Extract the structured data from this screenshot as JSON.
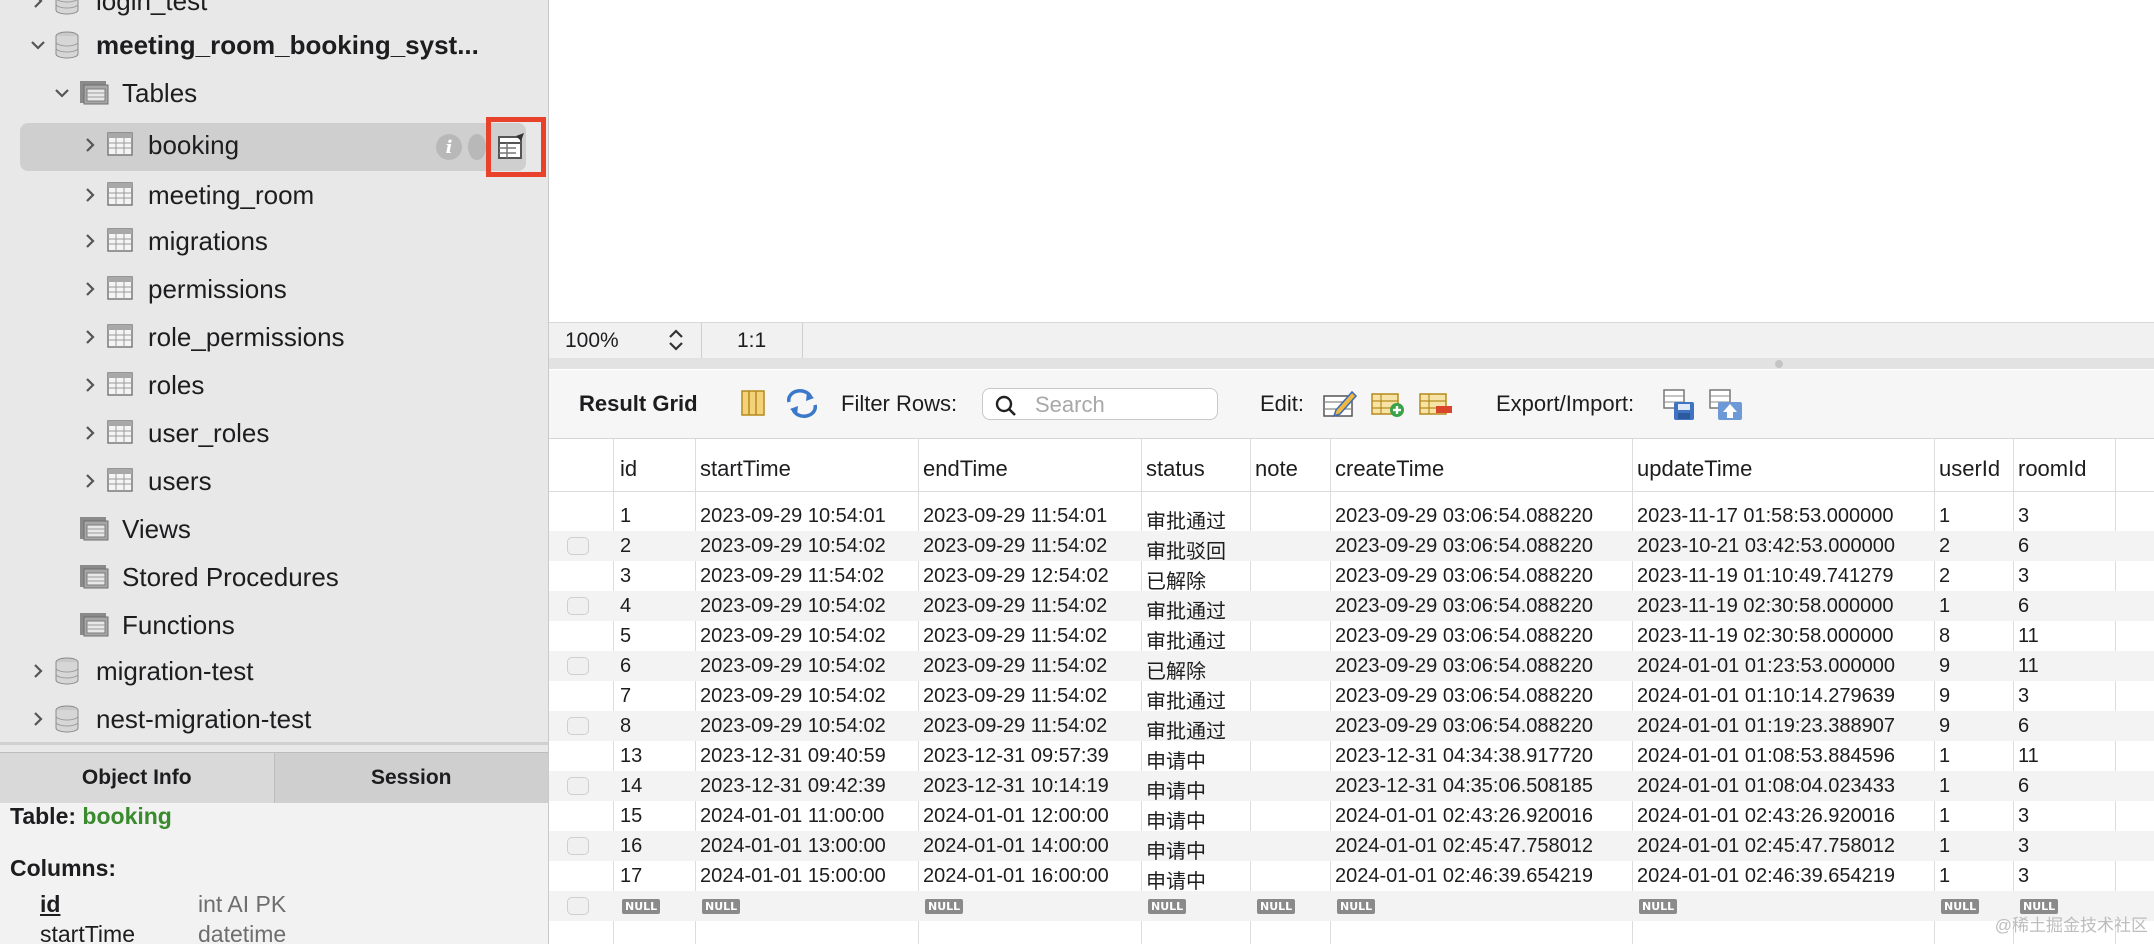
{
  "sidebar": {
    "items": [
      {
        "label": "login_test",
        "kind": "schema",
        "expanded": false
      },
      {
        "label": "meeting_room_booking_syst...",
        "kind": "schema",
        "expanded": true
      },
      {
        "label": "Tables",
        "kind": "folder",
        "expanded": true
      },
      {
        "label": "booking",
        "kind": "table",
        "selected": true
      },
      {
        "label": "meeting_room",
        "kind": "table"
      },
      {
        "label": "migrations",
        "kind": "table"
      },
      {
        "label": "permissions",
        "kind": "table"
      },
      {
        "label": "role_permissions",
        "kind": "table"
      },
      {
        "label": "roles",
        "kind": "table"
      },
      {
        "label": "user_roles",
        "kind": "table"
      },
      {
        "label": "users",
        "kind": "table"
      },
      {
        "label": "Views",
        "kind": "folder"
      },
      {
        "label": "Stored Procedures",
        "kind": "folder"
      },
      {
        "label": "Functions",
        "kind": "folder"
      },
      {
        "label": "migration-test",
        "kind": "schema",
        "expanded": false
      },
      {
        "label": "nest-migration-test",
        "kind": "schema",
        "expanded": false
      }
    ],
    "tabs": [
      "Object Info",
      "Session"
    ],
    "object_info": {
      "table_label": "Table:",
      "table_name": "booking",
      "columns_label": "Columns:",
      "columns": [
        {
          "name": "id",
          "type": "int AI PK"
        },
        {
          "name": "startTime",
          "type": "datetime"
        }
      ]
    },
    "highlight_color": "#e8412c"
  },
  "status": {
    "zoom": "100%",
    "position": "1:1"
  },
  "result_toolbar": {
    "title": "Result Grid",
    "filter_label": "Filter Rows:",
    "search_placeholder": "Search",
    "edit_label": "Edit:",
    "export_label": "Export/Import:"
  },
  "grid": {
    "columns": [
      "id",
      "startTime",
      "endTime",
      "status",
      "note",
      "createTime",
      "updateTime",
      "userId",
      "roomId"
    ],
    "rows": [
      [
        "1",
        "2023-09-29 10:54:01",
        "2023-09-29 11:54:01",
        "审批通过",
        "",
        "2023-09-29 03:06:54.088220",
        "2023-11-17 01:58:53.000000",
        "1",
        "3"
      ],
      [
        "2",
        "2023-09-29 10:54:02",
        "2023-09-29 11:54:02",
        "审批驳回",
        "",
        "2023-09-29 03:06:54.088220",
        "2023-10-21 03:42:53.000000",
        "2",
        "6"
      ],
      [
        "3",
        "2023-09-29 11:54:02",
        "2023-09-29 12:54:02",
        "已解除",
        "",
        "2023-09-29 03:06:54.088220",
        "2023-11-19 01:10:49.741279",
        "2",
        "3"
      ],
      [
        "4",
        "2023-09-29 10:54:02",
        "2023-09-29 11:54:02",
        "审批通过",
        "",
        "2023-09-29 03:06:54.088220",
        "2023-11-19 02:30:58.000000",
        "1",
        "6"
      ],
      [
        "5",
        "2023-09-29 10:54:02",
        "2023-09-29 11:54:02",
        "审批通过",
        "",
        "2023-09-29 03:06:54.088220",
        "2023-11-19 02:30:58.000000",
        "8",
        "11"
      ],
      [
        "6",
        "2023-09-29 10:54:02",
        "2023-09-29 11:54:02",
        "已解除",
        "",
        "2023-09-29 03:06:54.088220",
        "2024-01-01 01:23:53.000000",
        "9",
        "11"
      ],
      [
        "7",
        "2023-09-29 10:54:02",
        "2023-09-29 11:54:02",
        "审批通过",
        "",
        "2023-09-29 03:06:54.088220",
        "2024-01-01 01:10:14.279639",
        "9",
        "3"
      ],
      [
        "8",
        "2023-09-29 10:54:02",
        "2023-09-29 11:54:02",
        "审批通过",
        "",
        "2023-09-29 03:06:54.088220",
        "2024-01-01 01:19:23.388907",
        "9",
        "6"
      ],
      [
        "13",
        "2023-12-31 09:40:59",
        "2023-12-31 09:57:39",
        "申请中",
        "",
        "2023-12-31 04:34:38.917720",
        "2024-01-01 01:08:53.884596",
        "1",
        "11"
      ],
      [
        "14",
        "2023-12-31 09:42:39",
        "2023-12-31 10:14:19",
        "申请中",
        "",
        "2023-12-31 04:35:06.508185",
        "2024-01-01 01:08:04.023433",
        "1",
        "6"
      ],
      [
        "15",
        "2024-01-01 11:00:00",
        "2024-01-01 12:00:00",
        "申请中",
        "",
        "2024-01-01 02:43:26.920016",
        "2024-01-01 02:43:26.920016",
        "1",
        "3"
      ],
      [
        "16",
        "2024-01-01 13:00:00",
        "2024-01-01 14:00:00",
        "申请中",
        "",
        "2024-01-01 02:45:47.758012",
        "2024-01-01 02:45:47.758012",
        "1",
        "3"
      ],
      [
        "17",
        "2024-01-01 15:00:00",
        "2024-01-01 16:00:00",
        "申请中",
        "",
        "2024-01-01 02:46:39.654219",
        "2024-01-01 02:46:39.654219",
        "1",
        "3"
      ]
    ],
    "null_label": "NULL"
  },
  "watermark": "@稀土掘金技术社区"
}
